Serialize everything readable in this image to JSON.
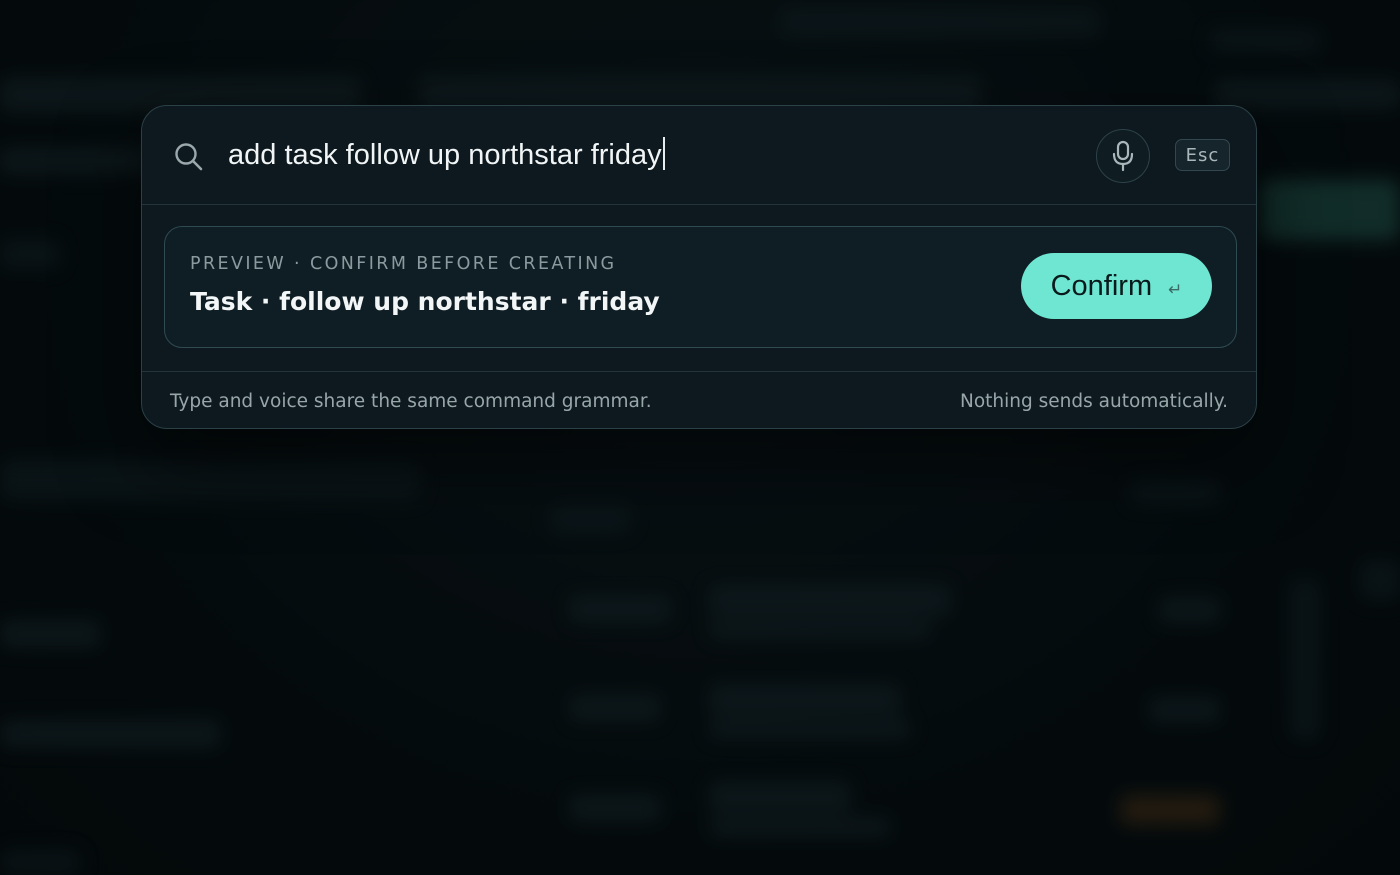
{
  "palette": {
    "search": {
      "value": "add task follow up northstar friday",
      "icon": "search-icon"
    },
    "mic": {
      "icon": "microphone-icon"
    },
    "esc_label": "Esc",
    "preview": {
      "label": "PREVIEW · CONFIRM BEFORE CREATING",
      "title": "Task · follow up northstar · friday"
    },
    "confirm": {
      "label": "Confirm",
      "shortcut_glyph": "↵"
    },
    "footer": {
      "left": "Type and voice share the same command grammar.",
      "right": "Nothing sends automatically."
    }
  },
  "colors": {
    "accent": "#6ee6d2",
    "panel": "#0d191f",
    "border": "#2b4047"
  }
}
